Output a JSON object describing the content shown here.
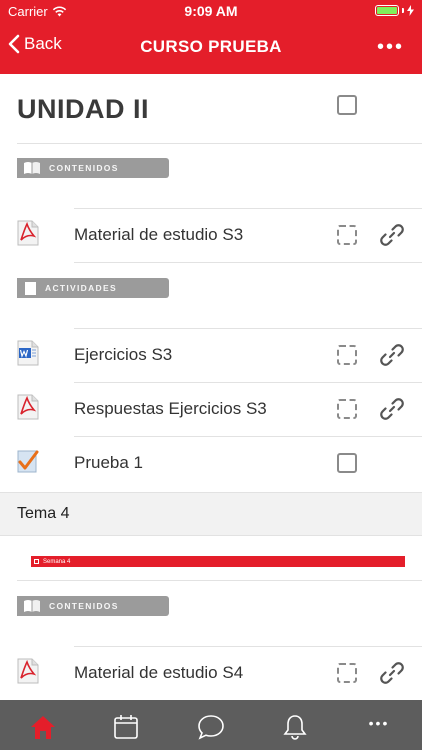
{
  "status": {
    "carrier": "Carrier",
    "time": "9:09 AM",
    "battery_level": 1.0
  },
  "nav": {
    "back_label": "Back",
    "title": "CURSO PRUEBA",
    "more_label": "•••"
  },
  "unit": {
    "title": "UNIDAD II"
  },
  "sections": {
    "contenidos_1": "CONTENIDOS",
    "actividades": "ACTIVIDADES",
    "contenidos_2": "CONTENIDOS"
  },
  "rows": [
    {
      "label": "Material de estudio S3",
      "file_icon": "pdf-icon"
    },
    {
      "label": "Ejercicios S3",
      "file_icon": "word-icon"
    },
    {
      "label": "Respuestas Ejercicios S3",
      "file_icon": "pdf-icon"
    },
    {
      "label": "Prueba 1",
      "file_icon": "quiz-icon"
    },
    {
      "label": "Material de estudio S4",
      "file_icon": "pdf-icon"
    }
  ],
  "tema": {
    "label": "Tema 4"
  },
  "banner": {
    "text": "Semana 4"
  },
  "tabbar": {
    "items": [
      "home-icon",
      "calendar-icon",
      "chat-icon",
      "bell-icon",
      "more-icon"
    ],
    "more_label": "•••"
  },
  "colors": {
    "brand": "#e41e2a",
    "tabbar": "#5d5d5d",
    "pill": "#9b9b9b"
  }
}
